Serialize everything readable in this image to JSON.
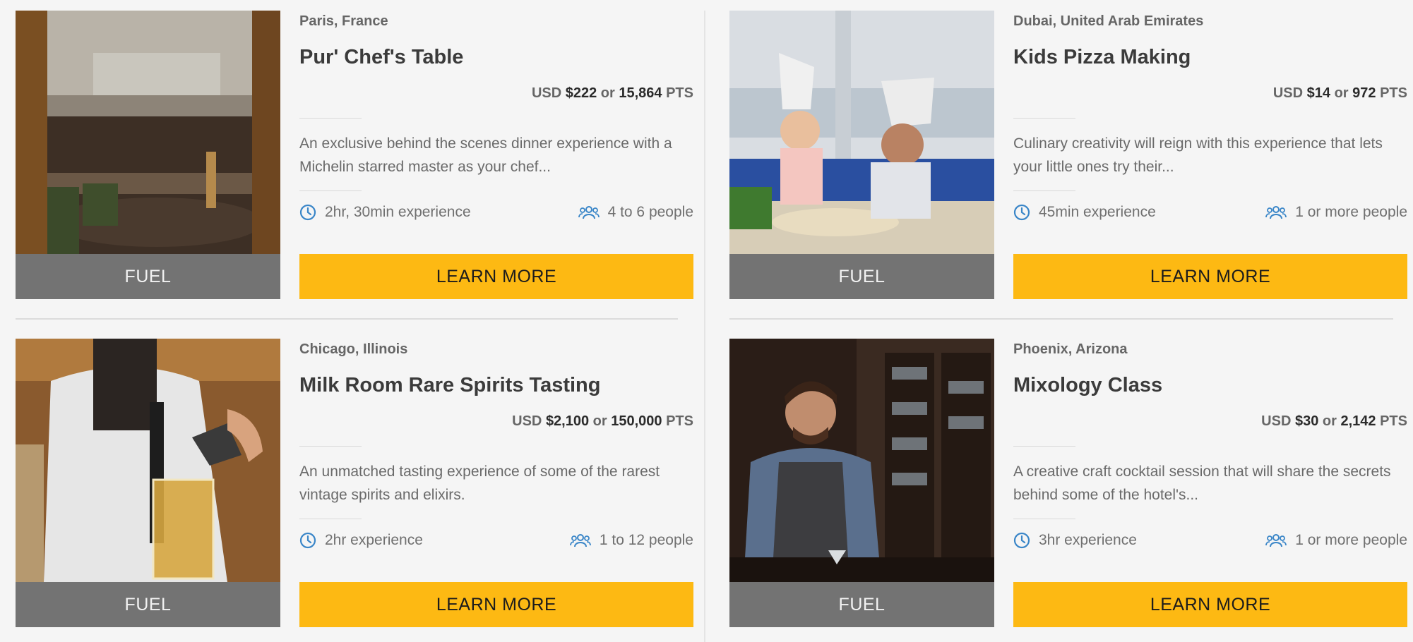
{
  "colors": {
    "accent": "#fdb913",
    "fuel_bg": "#737373",
    "icon": "#3a86c8"
  },
  "experiences": [
    {
      "location": "Paris, France",
      "title": "Pur' Chef's Table",
      "price_currency": "USD",
      "price_usd": "$222",
      "price_or": "or",
      "price_pts": "15,864",
      "price_pts_unit": "PTS",
      "description": "An exclusive behind the scenes dinner experience with a Michelin starred master as your chef...",
      "duration": "2hr, 30min experience",
      "people": "4 to 6 people",
      "badge": "FUEL",
      "cta": "LEARN MORE",
      "image_icon": "restaurant-interior-photo"
    },
    {
      "location": "Dubai, United Arab Emirates",
      "title": "Kids Pizza Making",
      "price_currency": "USD",
      "price_usd": "$14",
      "price_or": "or",
      "price_pts": "972",
      "price_pts_unit": "PTS",
      "description": "Culinary creativity will reign with this experience that lets your little ones try their...",
      "duration": "45min experience",
      "people": "1 or more people",
      "badge": "FUEL",
      "cta": "LEARN MORE",
      "image_icon": "kids-chef-photo"
    },
    {
      "location": "Chicago, Illinois",
      "title": "Milk Room Rare Spirits Tasting",
      "price_currency": "USD",
      "price_usd": "$2,100",
      "price_or": "or",
      "price_pts": "150,000",
      "price_pts_unit": "PTS",
      "description": "An unmatched tasting experience of some of the rarest vintage spirits and elixirs.",
      "duration": "2hr experience",
      "people": "1 to 12 people",
      "badge": "FUEL",
      "cta": "LEARN MORE",
      "image_icon": "spirits-pour-photo"
    },
    {
      "location": "Phoenix, Arizona",
      "title": "Mixology Class",
      "price_currency": "USD",
      "price_usd": "$30",
      "price_or": "or",
      "price_pts": "2,142",
      "price_pts_unit": "PTS",
      "description": "A creative craft cocktail session that will share the secrets behind some of the hotel's...",
      "duration": "3hr experience",
      "people": "1 or more people",
      "badge": "FUEL",
      "cta": "LEARN MORE",
      "image_icon": "bartender-photo"
    }
  ]
}
